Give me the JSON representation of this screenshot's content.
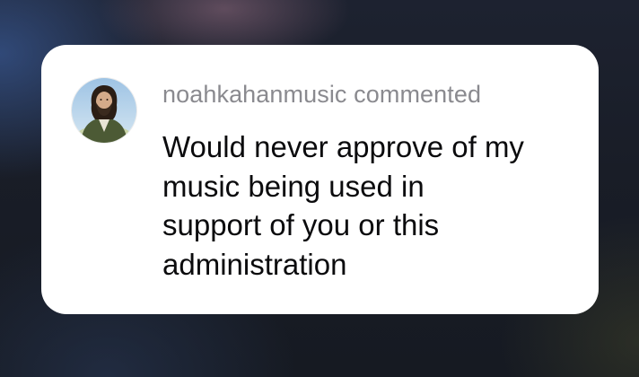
{
  "notification": {
    "username": "noahkahanmusic",
    "action": "commented",
    "message_lines": [
      "Would never approve of my",
      "music being used in",
      "support of you or this",
      "administration"
    ],
    "avatar_icon": "profile-photo-avatar"
  }
}
